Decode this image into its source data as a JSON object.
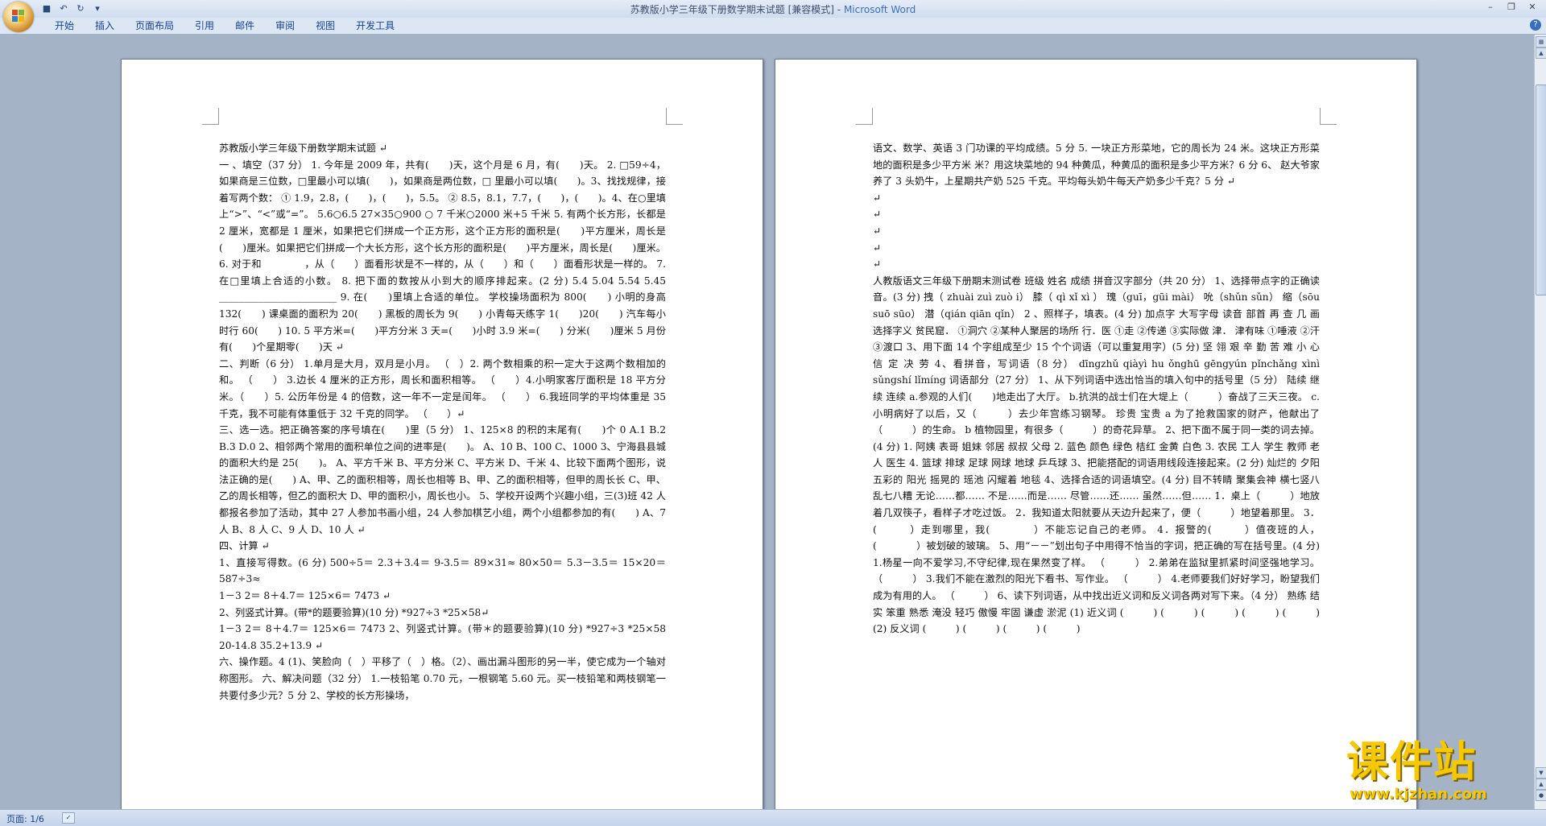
{
  "window": {
    "title": "苏教版小学三年级下册数学期末试题 [兼容模式]",
    "app_name": "Microsoft Word",
    "separator": " - "
  },
  "ribbon": {
    "tabs": [
      "开始",
      "插入",
      "页面布局",
      "引用",
      "邮件",
      "审阅",
      "视图",
      "开发工具"
    ]
  },
  "status_bar": {
    "page": "页面: 1/6"
  },
  "watermark": {
    "title": "课件站",
    "url": "www.kjzhan.com"
  },
  "page1": {
    "paragraphs": [
      "苏教版小学三年级下册数学期末试题 ↵",
      "一 、填空（37 分）  1. 今年是 2009 年，共有(　　)天，这个月是 6 月，有(　　)天。 2. □59÷4，如果商是三位数，□里最小可以填(　　)，如果商是两位数，□ 里最小可以填(　　)。3、找找规律，接着写两个数：  ① 1.9，2.8，(　　)，(　　)，5.5。  ② 8.5，8.1，7.7，(　　)，(　　)。4、在○里填上“>”、“<”或“=”。      5.6○6.5        27×35○900        ○ 7 千米○2000 米+5 千米  5. 有两个长方形，长都是 2 厘米，宽都是 1 厘米，如果把它们拼成一个正方形，这个正方形的面积是(　　)平方厘米，周长是(　　)厘米。如果把它们拼成一个大长方形，这个长方形的面积是(　　)平方厘米，周长是(　　)厘米。  6. 对于和 　　　　，从（　　）面看形状是不一样的，从（　　）和（　　）面看形状是一样的。  7. 在□里填上合适的小数。        8. 把下面的数按从小到大的顺序排起来。(2 分)  5.4        5.04        5.54        5.45        ________________________        9. 在(　　)里填上合适的单位。            学校操场面积为  800(　　)            小明的身高  132(　　)  课桌面的面积为 20(　　)            黑板的周长为 9(　　)      小青每天练字 1(　　)20(　　)  汽车每小时行 60(　　)  10. 5 平方米=(　　)平方分米            3 天=(　　)小时            3.9 米=(　　) 分米(　　)厘米        5 月份有(　　)个星期零(　　)天  ↵",
      "二、判断（6 分）  1.单月是大月，双月是小月。                                        （　）2. 两个数相乘的积一定大于这两个数相加的和。              （　　）  3.边长 4 厘米的正方形，周长和面积相等。                    （　　）4.小明家客厅面积是  18  平方分米。（　　）5. 公历年份是 4 的倍数，这一年不一定是闰年。            （　　）  6.我班同学的平均体重是 35 千克，我不可能有体重低于 32 千克的同学。            （　　）↵",
      "三、选一选。把正确答案的序号填在(　　)里（5 分）  1、125×8 的积的末尾有(　　)个  0  A.1              B.2              B.3              D.0  2、相邻两个常用的面积单位之间的进率是(　　)。      A、10              B、100            C、1000  3、宁海县县城的面积大约是  25(　　)。  A、平方千米      B、平方分米        C、平方米        D、千米  4、比较下面两个图形，说法正确的是(　　)  A、甲、乙的面积相等，周长也相等        B、甲、乙的面积相等，但甲的周长长  C、甲、乙的周长相等，但乙的面积大    D、甲的面积小，周长也小。    5、学校开设两个兴趣小组，三(3)班 42 人都报名参加了活动，其中 27 人参加书画小组，24 人参加棋艺小组，两个小组都参加的有(　　)        A、7 人          B、8 人          C、9 人          D、10 人  ↵",
      "四、计算 ↵",
      "  1、直接写得数。(6 分)  500÷5＝        2.3＋3.4＝        9-3.5＝        89×31≈        80×50＝  5.3－3.5＝          15×20＝          587÷3≈ ",
      "        1－3 2＝                8＋4.7＝                125×6＝                    7473  ↵",
      "        2、列竖式计算。(带*的题要验算)(10 分) *927÷3                              *25×58↵",
      "              1－3 2＝                8＋4.7＝                125×6＝                    7473    2、列竖式计算。(带＊的题要验算)(10 分)  *927÷3                                          *25×58                    20-14.8  35.2+13.9          ↵",
      "        六、操作题。4      (1)、笑脸向（　）平移了（　）格。（2）、画出漏斗图形的另一半，使它成为一个轴对称图形。                六、解决问题（32 分）    1.一枝铅笔 0.70 元，一根钢笔 5.60 元。买一枝铅笔和两枝钢笔一共要付多少元？5 分      2、学校的长方形操场，"
    ]
  },
  "page2": {
    "paragraphs": [
      "语文、数学、英语 3 门功课的平均成绩。5 分              5.  一块正方形菜地，它的周长为 24 米。这块正方形菜地的面积是多少平方米  米？用这块菜地的 94  种黄瓜，种黄瓜的面积是多少平方米？6 分            6、  赵大爷家养了 3 头奶牛，上星期共产奶 525 千克。平均每头奶牛每天产奶多少千克？5 分  ↵",
      "↵",
      "↵",
      "↵",
      "↵",
      "↵",
      "        人教版语文三年级下册期末测试卷    班级            姓名            成绩                    拼音汉字部分（共 20 分）    1、选择带点字的正确读音。(3 分)                                    拽（ zhuài zuì zuò i）    膝（ qì  xǐ  xì ）  瑰（guī，gūi mài）                吮（shǔn sǔn）    缩（sōu  suō sūo）      潜（qián qiān  qǐn）    2  、照样子，填表。(4 分)    加点字  大写字母  读音  部首  再  查  几  画          选择字义    贫民窟．            ①洞穴                                ②某种人聚居的场所              行．医        ①走    ②传递  ③实际做  津．  津有味        ①唾液  ②汗 ③渡口  3、用下面 14 个字组成至少 15 个个词语（可以重复用字）(5 分)    坚    翎    艰    辛    勤    苦    难    小    心    信    定    决    劳    4、看拼音，写词语（8 分）  dīngzhǔ  qiàyì  hu ǒnghū  gēngyún  pǐnchǎng  xìnì  sǔngshí  lǐmíng    词语部分（27 分）    1、从下列词语中选出恰当的填入句中的括号里（5 分）    陆续              继续                    连续      a.参观的人们(　　)地走出了大厅。  b.抗洪的战士们在大堤上（　　　）奋战了三天三夜。  c.小明病好了以后，又（　　　）去少年宫练习钢琴。    珍贵                                        宝贵        a 为了抢救国家的财产，他献出了（　　　）的生命。  b  植物园里，有很多（　　　）的奇花异草。  2、把下面不属于同一类的词去掉。(4 分)        1. 阿姨        表哥        姐妹        邻居      叔叔        父母        2.  蓝色        颜色        绿色        桔红        金黄        白色      3. 农民      工人        学生        教师        老人        医生        4.  篮球        排球        足球        网球        地球        乒乓球  3、把能搭配的词语用线段连接起来。(2 分)    灿烂的                                夕阳  五彩的                    阳光  摇晃的                        瑶池  闪耀着                        地毯  4、选择合适的词语填空。(4 分)    目不转睛              聚集会神              横七竖八                  乱七八糟  无论……都……                              不是……而是……    尽管……还……    虽然……但……    1．桌上（　　　）地放着几双筷子，看样子才吃过饭。  2．我知道太阳就要从天边升起来了，便（　　　）地望着那里。  3．(　　　）走到哪里，我(　　　　）不能忘记自己的老师。  4．报警的(　　　）值夜班的人，(　　　　）被划破的玻璃。  5、用“－－”划出句子中用得不恰当的字词，把正确的写在括号里。(4 分)    1.杨星一向不爱学习,不守纪律,现在果然变了样。                    （　　　）    2.弟弟在监狱里抓紧时间坚强地学习。                （　　　）  3.我们不能在激烈的阳光下看书、写作业。                                        （　　　）    4.老师要我们好好学习，盼望我们成为有用的人。          （　　　）          6、读下列词语，从中找出近义词和反义词各两对写下来。（4 分）    熟练        结实            笨重        熟悉            淹没    轻巧              傲慢            牢固  谦虚              淤泥    (1)  近义词      (　　　)              (　　　)                (　　　)                  (　　　)  (　　　)              (2)  反义词      (　　　)              (　　　)                (　　　)                  (　　　)"
    ]
  }
}
